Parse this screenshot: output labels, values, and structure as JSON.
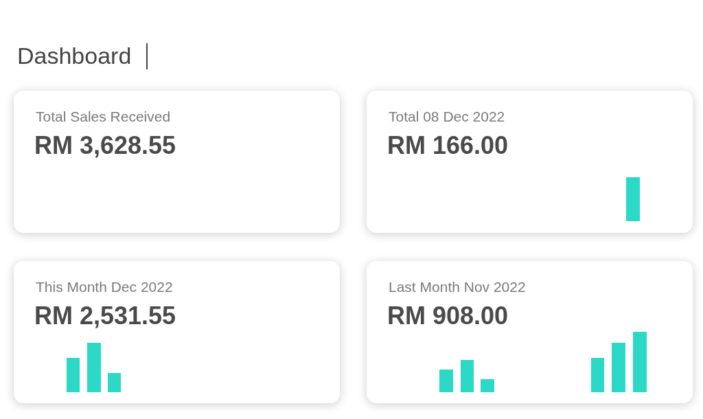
{
  "page": {
    "title": "Dashboard"
  },
  "cards": [
    {
      "label": "Total Sales Received",
      "amount": "RM 3,628.55"
    },
    {
      "label": "Total 08 Dec 2022",
      "amount": "RM 166.00"
    },
    {
      "label": "This Month Dec 2022",
      "amount": "RM 2,531.55"
    },
    {
      "label": "Last Month Nov 2022",
      "amount": "RM 908.00"
    }
  ]
}
